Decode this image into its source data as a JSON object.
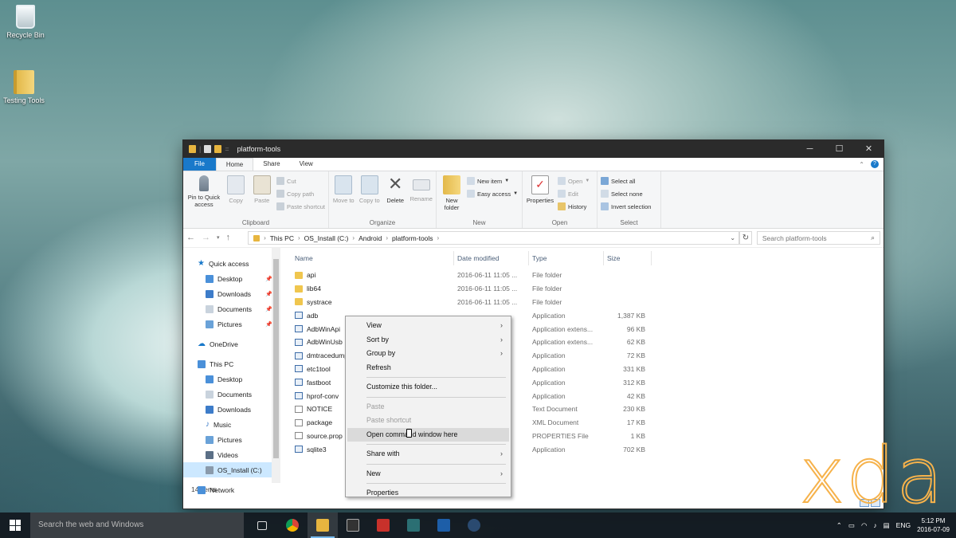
{
  "desktop": {
    "icons": [
      {
        "label": "Recycle Bin",
        "icon": "recycle-bin-icon"
      },
      {
        "label": "Testing Tools",
        "icon": "folder-icon"
      }
    ]
  },
  "window": {
    "title": "platform-tools",
    "controls": {
      "minimize": "─",
      "maximize": "☐",
      "close": "✕"
    }
  },
  "ribbon_tabs": [
    "File",
    "Home",
    "Share",
    "View"
  ],
  "ribbon": {
    "clipboard": {
      "name": "Clipboard",
      "pin": "Pin to Quick access",
      "copy": "Copy",
      "paste": "Paste",
      "cut": "Cut",
      "copy_path": "Copy path",
      "paste_shortcut": "Paste shortcut"
    },
    "organize": {
      "name": "Organize",
      "move_to": "Move to",
      "copy_to": "Copy to",
      "delete": "Delete",
      "rename": "Rename"
    },
    "new": {
      "name": "New",
      "new_folder": "New folder",
      "new_item": "New item",
      "easy_access": "Easy access"
    },
    "open": {
      "name": "Open",
      "properties": "Properties",
      "open": "Open",
      "edit": "Edit",
      "history": "History"
    },
    "select": {
      "name": "Select",
      "select_all": "Select all",
      "select_none": "Select none",
      "invert": "Invert selection"
    }
  },
  "address": {
    "crumbs": [
      "This PC",
      "OS_Install (C:)",
      "Android",
      "platform-tools"
    ],
    "search_placeholder": "Search platform-tools"
  },
  "navpane": {
    "quick_access": "Quick access",
    "quick_items": [
      "Desktop",
      "Downloads",
      "Documents",
      "Pictures"
    ],
    "onedrive": "OneDrive",
    "this_pc": "This PC",
    "pc_items": [
      "Desktop",
      "Documents",
      "Downloads",
      "Music",
      "Pictures",
      "Videos",
      "OS_Install (C:)"
    ],
    "network": "Network"
  },
  "columns": {
    "name": "Name",
    "date": "Date modified",
    "type": "Type",
    "size": "Size"
  },
  "files": [
    {
      "name": "api",
      "date": "2016-06-11 11:05 ...",
      "type": "File folder",
      "size": "",
      "kind": "folder"
    },
    {
      "name": "lib64",
      "date": "2016-06-11 11:05 ...",
      "type": "File folder",
      "size": "",
      "kind": "folder"
    },
    {
      "name": "systrace",
      "date": "2016-06-11 11:05 ...",
      "type": "File folder",
      "size": "",
      "kind": "folder"
    },
    {
      "name": "adb",
      "date": "",
      "type": "Application",
      "size": "1,387 KB",
      "kind": "app"
    },
    {
      "name": "AdbWinApi",
      "date": "",
      "type": "Application extens...",
      "size": "96 KB",
      "kind": "app"
    },
    {
      "name": "AdbWinUsb",
      "date": "",
      "type": "Application extens...",
      "size": "62 KB",
      "kind": "app"
    },
    {
      "name": "dmtracedump",
      "date": "",
      "type": "Application",
      "size": "72 KB",
      "kind": "app"
    },
    {
      "name": "etc1tool",
      "date": "",
      "type": "Application",
      "size": "331 KB",
      "kind": "app"
    },
    {
      "name": "fastboot",
      "date": "",
      "type": "Application",
      "size": "312 KB",
      "kind": "app"
    },
    {
      "name": "hprof-conv",
      "date": "",
      "type": "Application",
      "size": "42 KB",
      "kind": "app"
    },
    {
      "name": "NOTICE",
      "date": "",
      "type": "Text Document",
      "size": "230 KB",
      "kind": "doc"
    },
    {
      "name": "package",
      "date": "",
      "type": "XML Document",
      "size": "17 KB",
      "kind": "doc"
    },
    {
      "name": "source.prop",
      "date": "",
      "type": "PROPERTIES File",
      "size": "1 KB",
      "kind": "doc"
    },
    {
      "name": "sqlite3",
      "date": "",
      "type": "Application",
      "size": "702 KB",
      "kind": "app"
    }
  ],
  "status": {
    "items_count": "14 items"
  },
  "context_menu": {
    "view": "View",
    "sort_by": "Sort by",
    "group_by": "Group by",
    "refresh": "Refresh",
    "customize": "Customize this folder...",
    "paste": "Paste",
    "paste_shortcut": "Paste shortcut",
    "open_cmd": "Open command window here",
    "share_with": "Share with",
    "new": "New",
    "properties": "Properties"
  },
  "taskbar": {
    "search_placeholder": "Search the web and Windows",
    "tray_language": "ENG",
    "time": "5:12 PM",
    "date": "2016-07-09"
  },
  "watermark": "xda",
  "colors": {
    "accent": "#1979ca",
    "titlebar": "#2b2b2b",
    "selection": "#cce8ff",
    "watermark": "#f6b24b"
  }
}
